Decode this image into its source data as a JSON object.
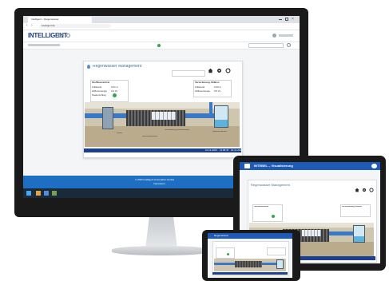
{
  "desktop": {
    "browser_tab": "Intelligent – Regenwasser",
    "url": "intelligent.de",
    "logo": "INTELLIGENT",
    "app_title": "Regenwasser Management",
    "left_panel": {
      "title": "Stoffkonzentrat",
      "rows": [
        {
          "label": "Füllstand",
          "value": "0.01 m"
        },
        {
          "label": "Abflussmenge",
          "value": "0.0 l/s"
        },
        {
          "label": "Niederschlag",
          "value": ""
        }
      ]
    },
    "right_panel": {
      "title": "Versickerung Abfluss",
      "rows": [
        {
          "label": "Füllstand",
          "value": "0.00 m"
        },
        {
          "label": "Abflussmenge",
          "value": "0.0 l/s"
        }
      ]
    },
    "scene_labels": [
      "Zulauf",
      "Rückhaltebecken",
      "Versickerung Abflussbecken",
      "Speicherbecken"
    ],
    "status_items": [
      "10.11.2023",
      "11:05:46",
      "16.11.2023"
    ],
    "footer_lines": [
      "© 2023 Intelligent Automation GmbH",
      "Impressum"
    ],
    "toolbar_icons": [
      "home-icon",
      "gear-icon",
      "refresh-icon"
    ],
    "colors": {
      "brand": "#1d3f8f",
      "footer": "#1e6fc4",
      "tablet_header": "#1e5bb8",
      "status_ok": "#2fa84f"
    }
  },
  "tablet": {
    "header_title": "INTEBEL – Visualisierung",
    "app_title": "Regenwasser Management",
    "left_panel_title": "Stoffkonzentrat",
    "right_panel_title": "Versickerung Abfluss"
  },
  "phone": {
    "header_title": "Regenwasser"
  }
}
